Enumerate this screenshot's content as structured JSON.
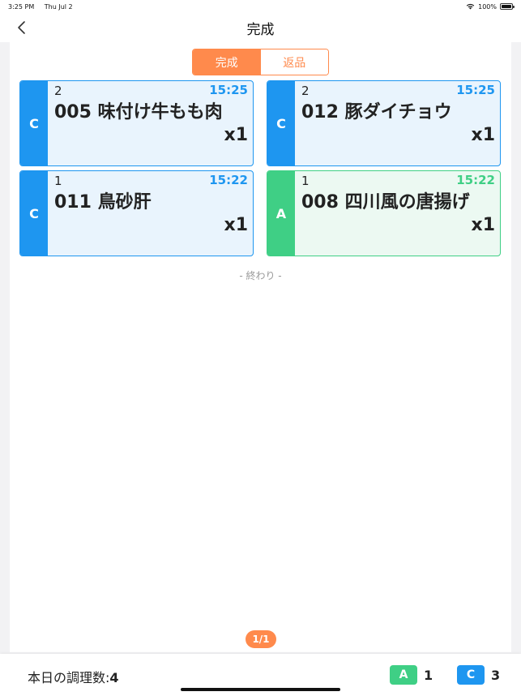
{
  "status": {
    "time": "3:25 PM",
    "date": "Thu Jul 2",
    "battery": "100%"
  },
  "header": {
    "title": "完成"
  },
  "tabs": [
    {
      "label": "完成",
      "active": true
    },
    {
      "label": "返品",
      "active": false
    }
  ],
  "orders": [
    {
      "tag": "C",
      "count": "2",
      "time": "15:25",
      "name": "005 味付け牛もも肉",
      "qty": "x1",
      "color": "#1e96f0"
    },
    {
      "tag": "C",
      "count": "2",
      "time": "15:25",
      "name": "012 豚ダイチョウ",
      "qty": "x1",
      "color": "#1e96f0"
    },
    {
      "tag": "C",
      "count": "1",
      "time": "15:22",
      "name": "011 鳥砂肝",
      "qty": "x1",
      "color": "#1e96f0"
    },
    {
      "tag": "A",
      "count": "1",
      "time": "15:22",
      "name": "008 四川風の唐揚げ",
      "qty": "x1",
      "color": "#3fcf85"
    }
  ],
  "end_label": "- 終わり -",
  "pagination": "1/1",
  "footer": {
    "label": "本日の調理数:",
    "total": "4",
    "legend": [
      {
        "tag": "A",
        "count": "1",
        "color": "#3fcf85"
      },
      {
        "tag": "C",
        "count": "3",
        "color": "#1e96f0"
      }
    ]
  },
  "colors": {
    "accent": "#ff8a4c"
  }
}
